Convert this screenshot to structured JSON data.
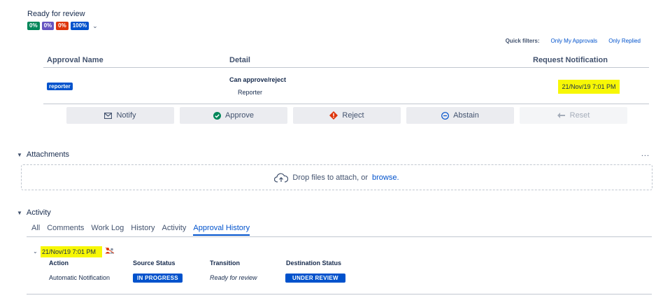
{
  "status": {
    "title": "Ready for review",
    "percents": [
      {
        "label": "0%",
        "color": "#00875a"
      },
      {
        "label": "0%",
        "color": "#6554c0"
      },
      {
        "label": "0%",
        "color": "#de350b"
      },
      {
        "label": "100%",
        "color": "#0052cc"
      }
    ]
  },
  "quick_filters": {
    "label": "Quick filters:",
    "items": [
      "Only My Approvals",
      "Only Replied"
    ]
  },
  "approval_table": {
    "headers": {
      "name": "Approval Name",
      "detail": "Detail",
      "notification": "Request Notification"
    },
    "row": {
      "role": "reporter",
      "detail_title": "Can approve/reject",
      "detail_sub": "Reporter",
      "notification_date": "21/Nov/19 7:01 PM"
    }
  },
  "actions": {
    "notify": "Notify",
    "approve": "Approve",
    "reject": "Reject",
    "abstain": "Abstain",
    "reset": "Reset"
  },
  "attachments": {
    "title": "Attachments",
    "more": "...",
    "drop_text": "Drop files to attach, or",
    "browse": "browse."
  },
  "activity": {
    "title": "Activity",
    "tabs": [
      "All",
      "Comments",
      "Work Log",
      "History",
      "Activity",
      "Approval History"
    ],
    "active_tab": "Approval History",
    "entry": {
      "date": "21/Nov/19 7:01 PM",
      "headers": {
        "action": "Action",
        "source": "Source Status",
        "transition": "Transition",
        "destination": "Destination Status"
      },
      "action": "Automatic Notification",
      "source": "IN PROGRESS",
      "transition": "Ready for review",
      "destination": "UNDER REVIEW"
    }
  },
  "icons": {
    "notify": "envelope-icon",
    "approve": "check-circle-icon",
    "reject": "warning-diamond-icon",
    "abstain": "minus-circle-icon",
    "reset": "undo-arrow-icon",
    "upload": "cloud-upload-icon",
    "history": "user-change-icon"
  }
}
